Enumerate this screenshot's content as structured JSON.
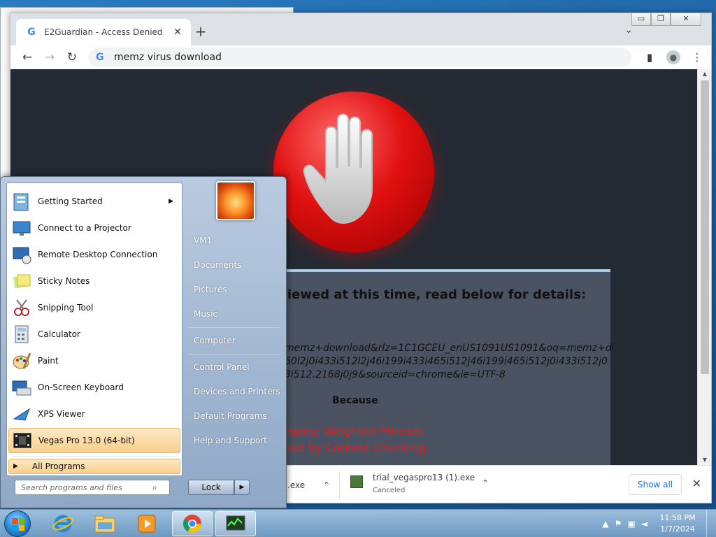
{
  "browser": {
    "tab_title": "E2Guardian - Access Denied",
    "tab_close": "✕",
    "new_tab": "+",
    "tab_search": "⌄",
    "window_buttons": [
      "▭",
      "❐",
      "✕"
    ],
    "back": "←",
    "forward": "→",
    "reload": "↻",
    "omnibox_value": "memz virus download",
    "omnibox_g": "G",
    "sidepanel_icon": "▮",
    "menu_icon": "⋮"
  },
  "page": {
    "heading_visible": "iewed at this time, read below for details:",
    "url_lines": [
      "memz+download&rlz=1C1GCEU_enUS1091US1091&oq=memz+dow",
      "50l2j0i433i512l2j46i199i433i465i512j46i199i465i512j0i433i512j0",
      "3i512.2168j0j9&sourceid=chrome&ie=UTF-8"
    ],
    "because": "Because",
    "reason_lines": [
      "egory: Weighted Phrases",
      "ked by Content Checking."
    ],
    "accent_color": "#e21c1c"
  },
  "downloads": {
    "item1_name": ".exe",
    "item2_name": "trial_vegaspro13 (1).exe",
    "item2_status": "Canceled",
    "show_all": "Show all",
    "close": "✕",
    "chevron": "⌃"
  },
  "start_menu": {
    "programs": [
      {
        "label": "Getting Started",
        "icon": "getting-started-icon",
        "has_submenu": true
      },
      {
        "label": "Connect to a Projector",
        "icon": "projector-icon"
      },
      {
        "label": "Remote Desktop Connection",
        "icon": "remote-desktop-icon"
      },
      {
        "label": "Sticky Notes",
        "icon": "sticky-notes-icon"
      },
      {
        "label": "Snipping Tool",
        "icon": "snipping-tool-icon"
      },
      {
        "label": "Calculator",
        "icon": "calculator-icon"
      },
      {
        "label": "Paint",
        "icon": "paint-icon"
      },
      {
        "label": "On-Screen Keyboard",
        "icon": "keyboard-icon"
      },
      {
        "label": "XPS Viewer",
        "icon": "xps-viewer-icon"
      },
      {
        "label": "Vegas Pro 13.0 (64-bit)",
        "icon": "vegas-pro-icon",
        "highlighted": true
      }
    ],
    "all_programs": "All Programs",
    "search_placeholder": "Search programs and files",
    "right_items": [
      "VM1",
      "Documents",
      "Pictures",
      "Music",
      "Computer",
      "Control Panel",
      "Devices and Printers",
      "Default Programs",
      "Help and Support"
    ],
    "lock": "Lock",
    "submenu_arrow": "▶"
  },
  "taskbar": {
    "time": "11:58 PM",
    "date": "1/7/2024",
    "tray_arrow": "▲"
  }
}
